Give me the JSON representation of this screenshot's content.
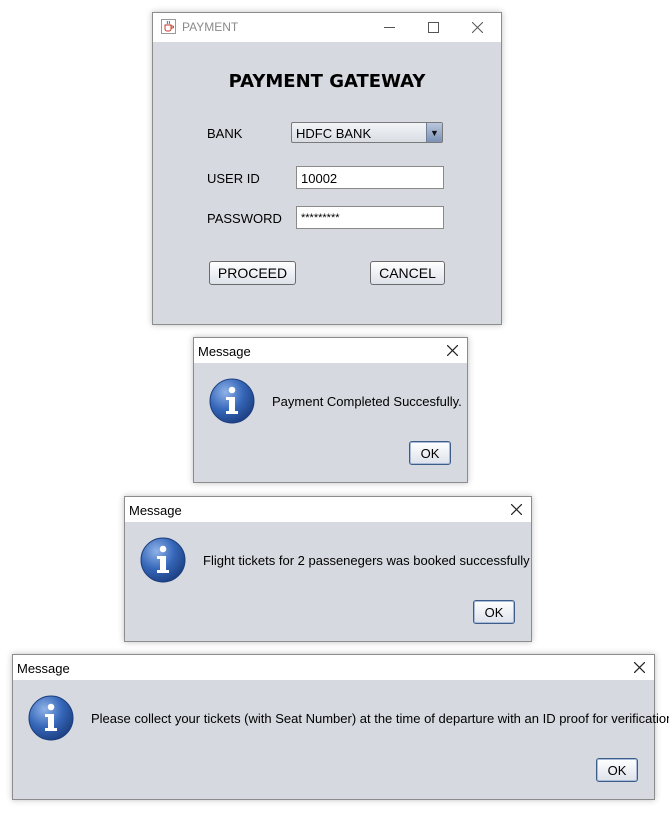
{
  "payment_window": {
    "title": "PAYMENT",
    "heading": "PAYMENT GATEWAY",
    "bank_label": "BANK",
    "bank_selected": "HDFC BANK",
    "user_id_label": "USER ID",
    "user_id_value": "10002",
    "password_label": "PASSWORD",
    "password_value": "*********",
    "proceed_label": "PROCEED",
    "cancel_label": "CANCEL",
    "title_color": "#8a8a8a",
    "icons": {
      "app": "java-coffee-icon",
      "minimize": "minimize-icon",
      "maximize": "maximize-icon",
      "close": "close-icon"
    }
  },
  "dialogs": [
    {
      "title": "Message",
      "message": "Payment Completed Succesfully.",
      "ok_label": "OK",
      "icon": "info-icon"
    },
    {
      "title": "Message",
      "message": "Flight tickets for 2 passenegers was booked successfully",
      "ok_label": "OK",
      "icon": "info-icon"
    },
    {
      "title": "Message",
      "message": "Please collect your tickets (with Seat Number) at the time of departure with an ID proof for verification.",
      "ok_label": "OK",
      "icon": "info-icon"
    }
  ],
  "colors": {
    "window_bg": "#d6d9df",
    "info_icon_blue": "#2d5fae"
  }
}
